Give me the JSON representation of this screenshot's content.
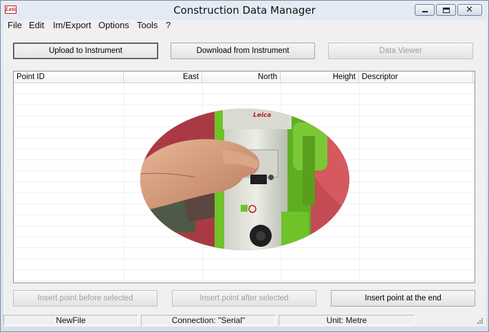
{
  "window": {
    "title": "Construction Data Manager",
    "logo_text": "Leica"
  },
  "menu": [
    "File",
    "Edit",
    "Im/Export",
    "Options",
    "Tools",
    "?"
  ],
  "toolbar": {
    "upload_label": "Upload to Instrument",
    "download_label": "Download from Instrument",
    "viewer_label": "Data Viewer"
  },
  "table": {
    "columns": [
      "Point ID",
      "East",
      "North",
      "Height",
      "Descriptor"
    ],
    "rows": []
  },
  "video_overlay": {
    "instrument_brand": "Leica"
  },
  "actions": {
    "insert_before_label": "Insert point before selected",
    "insert_after_label": "Insert point after selected",
    "insert_end_label": "Insert point at the end"
  },
  "status": {
    "file": "NewFile",
    "connection": "Connection: \"Serial\"",
    "unit": "Unit: Metre"
  },
  "colors": {
    "instrument_green": "#6fc22a",
    "brand_red": "#c01820"
  }
}
